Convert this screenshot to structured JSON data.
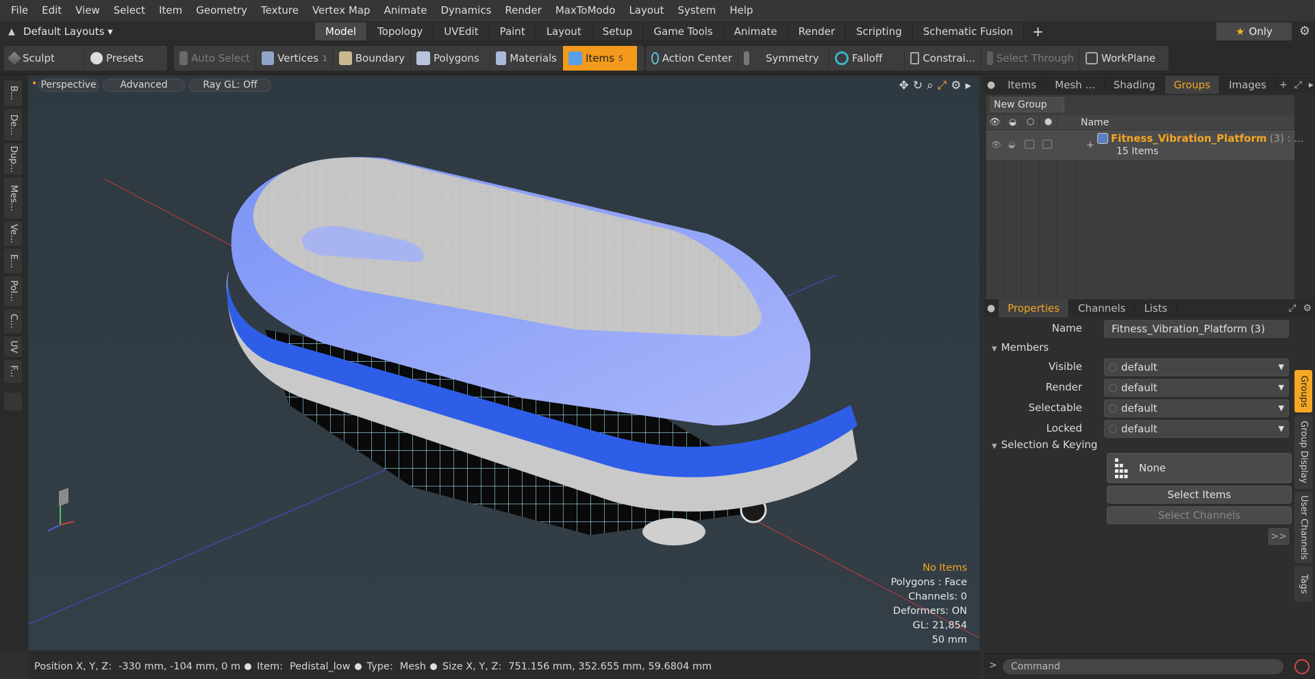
{
  "menu": [
    "File",
    "Edit",
    "View",
    "Select",
    "Item",
    "Geometry",
    "Texture",
    "Vertex Map",
    "Animate",
    "Dynamics",
    "Render",
    "MaxToModo",
    "Layout",
    "System",
    "Help"
  ],
  "layout_selector": "Default Layouts ▾",
  "tabs": [
    "Model",
    "Topology",
    "UVEdit",
    "Paint",
    "Layout",
    "Setup",
    "Game Tools",
    "Animate",
    "Render",
    "Scripting",
    "Schematic Fusion"
  ],
  "active_tab": "Model",
  "tab_plus": "+",
  "only_label": "Only",
  "toolbar": {
    "sculpt": "Sculpt",
    "presets": "Presets",
    "auto_select": "Auto Select",
    "vertices": "Vertices",
    "vertices_count": "1",
    "boundary": "Boundary",
    "polygons": "Polygons",
    "materials": "Materials",
    "items": "Items",
    "items_count": "5",
    "action_center": "Action Center",
    "symmetry": "Symmetry",
    "falloff": "Falloff",
    "constraints": "Constrai...",
    "select_through": "Select Through",
    "workplane": "WorkPlane"
  },
  "left_tabs": [
    "B...",
    "De...",
    "Dup...",
    "Mes...",
    "Ve...",
    "E...",
    "Pol...",
    "C...",
    "UV",
    "F..."
  ],
  "viewport": {
    "perspective": "Perspective",
    "advanced": "Advanced",
    "raygl": "Ray GL: Off",
    "info": {
      "items": "No Items",
      "polygons": "Polygons : Face",
      "channels": "Channels: 0",
      "deformers": "Deformers: ON",
      "gl": "GL: 21,854",
      "scale": "50 mm"
    }
  },
  "status": {
    "position_label": "Position X, Y, Z:",
    "position_value": "-330 mm, -104 mm, 0 m",
    "item_label": "Item:",
    "item_value": "Pedistal_low",
    "type_label": "Type:",
    "type_value": "Mesh",
    "size_label": "Size X, Y, Z:",
    "size_value": "751.156 mm, 352.655 mm, 59.6804 mm"
  },
  "panel_tabs": [
    "Items",
    "Mesh ...",
    "Shading",
    "Groups",
    "Images"
  ],
  "active_panel_tab": "Groups",
  "groups": {
    "new_group": "New Group",
    "name_header": "Name",
    "row_name": "Fitness_Vibration_Platform",
    "row_count": "(3) : ...",
    "row_sub": "15 Items"
  },
  "prop_tabs": [
    "Properties",
    "Channels",
    "Lists"
  ],
  "properties": {
    "name_label": "Name",
    "name_value": "Fitness_Vibration_Platform (3)",
    "members": "Members",
    "visible_label": "Visible",
    "render_label": "Render",
    "selectable_label": "Selectable",
    "locked_label": "Locked",
    "default_value": "default",
    "selection_keying": "Selection & Keying",
    "none_label": "None",
    "select_items": "Select Items",
    "select_channels": "Select Channels",
    "more": ">>"
  },
  "right_vtabs": [
    "Groups",
    "Group Display",
    "User Channels",
    "Tags"
  ],
  "command_placeholder": "Command",
  "colors": {
    "accent": "#f5a623",
    "blue": "#3f6be0"
  }
}
